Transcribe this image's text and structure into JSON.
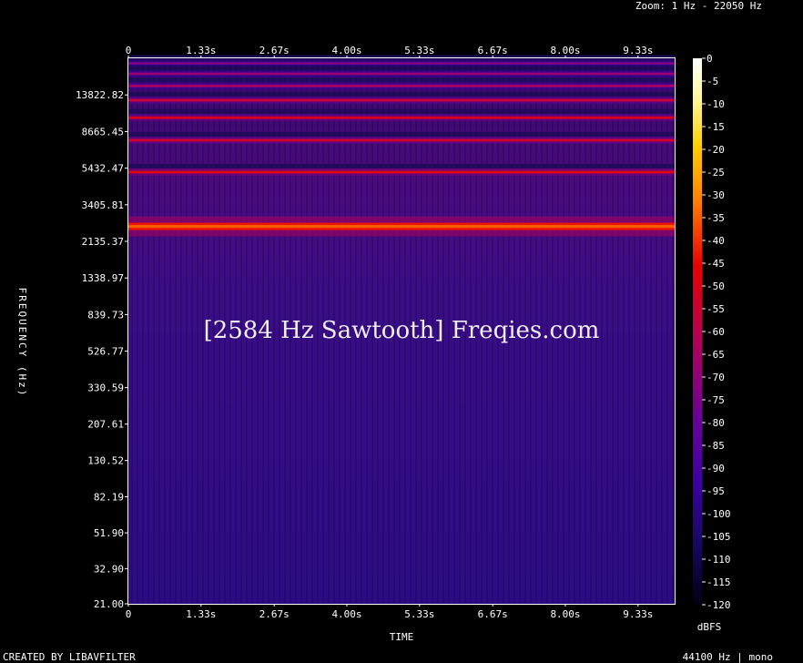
{
  "header": {
    "zoom": "Zoom: 1 Hz - 22050 Hz"
  },
  "footer": {
    "left": "CREATED BY LIBAVFILTER",
    "right": "44100 Hz | mono"
  },
  "chart_data": {
    "type": "heatmap",
    "title": "[2584 Hz Sawtooth] Freqies.com",
    "xlabel": "TIME",
    "ylabel": "FREQUENCY (Hz)",
    "x_ticks": [
      "0",
      "1.33s",
      "2.67s",
      "4.00s",
      "5.33s",
      "6.67s",
      "8.00s",
      "9.33s"
    ],
    "x_tick_values": [
      0,
      1.33,
      2.67,
      4.0,
      5.33,
      6.67,
      8.0,
      9.33
    ],
    "xlim": [
      0,
      10
    ],
    "y_scale": "log",
    "y_ticks": [
      "13822.82",
      "8665.45",
      "5432.47",
      "3405.81",
      "2135.37",
      "1338.97",
      "839.73",
      "526.77",
      "330.59",
      "207.61",
      "130.52",
      "82.19",
      "51.90",
      "32.90",
      "21.00"
    ],
    "y_tick_values": [
      13822.82,
      8665.45,
      5432.47,
      3405.81,
      2135.37,
      1338.97,
      839.73,
      526.77,
      330.59,
      207.61,
      130.52,
      82.19,
      51.9,
      32.9,
      21.0
    ],
    "ylim": [
      21,
      22050
    ],
    "colorbar": {
      "label": "dBFS",
      "ticks": [
        "0",
        "-5",
        "-10",
        "-15",
        "-20",
        "-25",
        "-30",
        "-35",
        "-40",
        "-45",
        "-50",
        "-55",
        "-60",
        "-65",
        "-70",
        "-75",
        "-80",
        "-85",
        "-90",
        "-95",
        "-100",
        "-105",
        "-110",
        "-115",
        "-120"
      ],
      "range": [
        -120,
        0
      ]
    },
    "harmonics": [
      {
        "freq_hz": 2584,
        "level_dbfs": -35
      },
      {
        "freq_hz": 5168,
        "level_dbfs": -45
      },
      {
        "freq_hz": 7752,
        "level_dbfs": -50
      },
      {
        "freq_hz": 10336,
        "level_dbfs": -48
      },
      {
        "freq_hz": 12920,
        "level_dbfs": -52
      },
      {
        "freq_hz": 15504,
        "level_dbfs": -62
      },
      {
        "freq_hz": 18088,
        "level_dbfs": -66
      },
      {
        "freq_hz": 20672,
        "level_dbfs": -72
      }
    ],
    "background_level_dbfs": -95
  }
}
